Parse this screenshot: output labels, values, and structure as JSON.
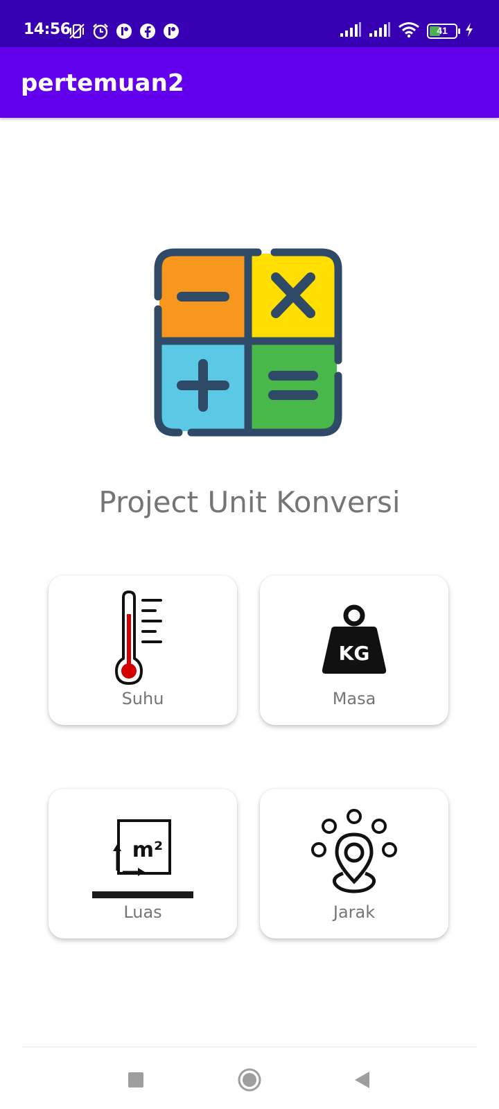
{
  "status_bar": {
    "time": "14:56",
    "battery_level": "41",
    "left_icons": [
      "vibrate-off-icon",
      "alarm-icon",
      "app-notification-icon",
      "facebook-icon",
      "app-notification-icon"
    ],
    "right_icons": [
      "signal-icon",
      "signal-icon",
      "wifi-icon",
      "battery-icon",
      "charging-icon"
    ],
    "battery_fill_percent": 41
  },
  "app_bar": {
    "title": "pertemuan2"
  },
  "main": {
    "logo_icon": "calculator-operations-icon",
    "project_title": "Project Unit Konversi",
    "menu": [
      {
        "label": "Suhu",
        "icon": "thermometer-icon"
      },
      {
        "label": "Masa",
        "icon": "weight-kg-icon"
      },
      {
        "label": "Luas",
        "icon": "area-m2-icon"
      },
      {
        "label": "Jarak",
        "icon": "location-distance-icon"
      }
    ]
  },
  "nav_bar": {
    "buttons": [
      "recents-button",
      "home-button",
      "back-button"
    ]
  },
  "colors": {
    "status_bar": "#3700b3",
    "app_bar": "#6200ee",
    "label_text": "#757575"
  }
}
